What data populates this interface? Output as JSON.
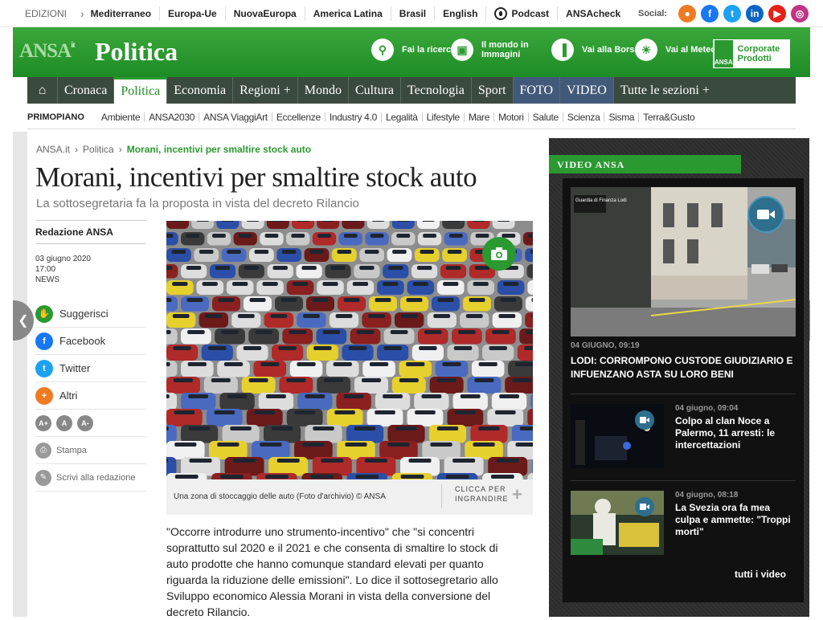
{
  "topbar": {
    "editions_label": "EDIZIONI",
    "links": [
      "Mediterraneo",
      "Europa-Ue",
      "NuovaEuropa",
      "America Latina",
      "Brasil",
      "English",
      "Podcast",
      "ANSAcheck"
    ],
    "social_label": "Social:",
    "social_icons": [
      "rss-icon",
      "facebook-icon",
      "twitter-icon",
      "linkedin-icon",
      "youtube-icon",
      "instagram-icon"
    ]
  },
  "header": {
    "logo": "ANSA",
    "logo_suffix": "it",
    "section": "Politica",
    "buttons": [
      {
        "label": "Fai la ricerca",
        "icon": "search-icon"
      },
      {
        "label": "Il mondo in Immagini",
        "icon": "photo-icon"
      },
      {
        "label": "Vai alla Borsa",
        "icon": "chart-icon"
      },
      {
        "label": "Vai al Meteo",
        "icon": "weather-icon"
      }
    ],
    "corporate": {
      "logo": "ANSA",
      "label": "Corporate Prodotti"
    }
  },
  "nav": {
    "items": [
      "Cronaca",
      "Politica",
      "Economia",
      "Regioni +",
      "Mondo",
      "Cultura",
      "Tecnologia",
      "Sport",
      "FOTO",
      "VIDEO",
      "Tutte le sezioni +"
    ],
    "active": "Politica"
  },
  "subnav": {
    "primary": "PRIMOPIANO",
    "items": [
      "Ambiente",
      "ANSA2030",
      "ANSA ViaggiArt",
      "Eccellenze",
      "Industry 4.0",
      "Legalità",
      "Lifestyle",
      "Mare",
      "Motori",
      "Salute",
      "Scienza",
      "Sisma",
      "Terra&Gusto"
    ]
  },
  "breadcrumb": [
    "ANSA.it",
    "Politica",
    "Morani, incentivi per smaltire stock auto"
  ],
  "article": {
    "title": "Morani, incentivi per smaltire stock auto",
    "subtitle": "La sottosegretaria fa la proposta in vista del decreto Rilancio",
    "author": "Redazione ANSA",
    "date": "03 giugno 2020",
    "time": "17:00",
    "type": "NEWS",
    "caption": "Una zona di stoccaggio delle auto (Foto d'archivio) © ANSA",
    "zoom_label": "CLICCA PER INGRANDIRE",
    "body": "\"Occorre introdurre uno strumento-incentivo\" che \"si concentri soprattutto sul 2020 e il 2021 e che consenta di smaltire lo stock di auto prodotte che hanno comunque standard elevati per quanto riguarda la riduzione delle emissioni\". Lo dice il sottosegretario allo Sviluppo economico Alessia Morani in vista della conversione del decreto Rilancio."
  },
  "share": {
    "suggest": "Suggerisci",
    "facebook": "Facebook",
    "twitter": "Twitter",
    "others": "Altri",
    "font_sizes": [
      "A+",
      "A",
      "A-"
    ],
    "print": "Stampa",
    "write": "Scrivi alla redazione"
  },
  "video": {
    "tab": "VIDEO ANSA",
    "main": {
      "date": "04 GIUGNO, 09:19",
      "title": "LODI: CORROMPONO CUSTODE GIUDIZIARIO E INFUENZANO ASTA SU LORO BENI",
      "sign": "Guardia di Finanza Lodi"
    },
    "items": [
      {
        "date": "04 giugno, 09:04",
        "title": "Colpo al clan Noce a Palermo, 11 arresti: le intercettazioni"
      },
      {
        "date": "04 giugno, 08:18",
        "title": "La Svezia ora fa mea culpa e ammette: \"Troppi morti\""
      }
    ],
    "all": "tutti i video"
  },
  "colors": {
    "brand_green": "#2a9a30",
    "nav_dark": "#3b4a3e",
    "nav_blue": "#425a7a"
  }
}
